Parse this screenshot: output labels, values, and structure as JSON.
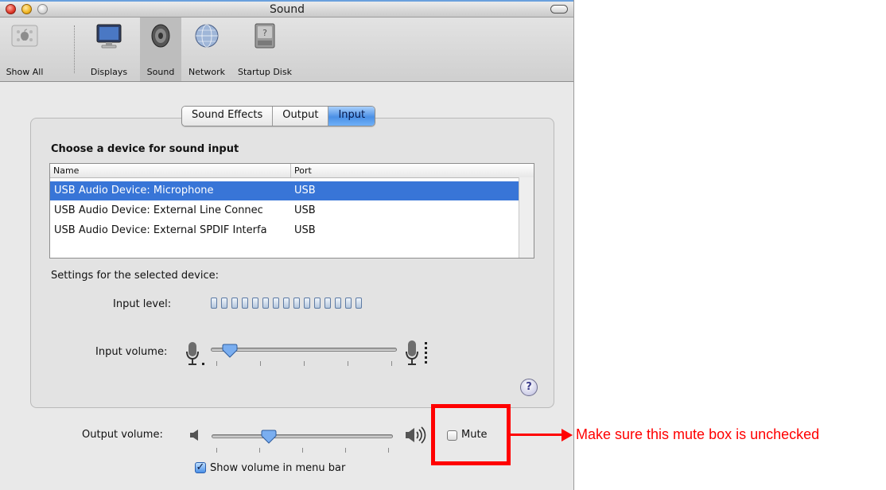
{
  "window": {
    "title": "Sound"
  },
  "toolbar": {
    "items": [
      {
        "label": "Show All",
        "icon": "apple-icon"
      },
      {
        "label": "Displays",
        "icon": "display-icon"
      },
      {
        "label": "Sound",
        "icon": "speaker-icon"
      },
      {
        "label": "Network",
        "icon": "globe-icon"
      },
      {
        "label": "Startup Disk",
        "icon": "disk-icon"
      }
    ],
    "selected": "Sound"
  },
  "tabs": [
    {
      "label": "Sound Effects",
      "active": false
    },
    {
      "label": "Output",
      "active": false
    },
    {
      "label": "Input",
      "active": true
    }
  ],
  "input": {
    "heading": "Choose a device for sound input",
    "columns": {
      "name": "Name",
      "port": "Port"
    },
    "devices": [
      {
        "name": "USB Audio Device: Microphone",
        "port": "USB",
        "selected": true
      },
      {
        "name": "USB Audio Device: External Line Connec",
        "port": "USB",
        "selected": false
      },
      {
        "name": "USB Audio Device: External SPDIF Interfa",
        "port": "USB",
        "selected": false
      }
    ],
    "settings_label": "Settings for the selected device:",
    "input_level_label": "Input level:",
    "input_level_segments": 15,
    "input_level_lit": 0,
    "input_volume_label": "Input volume:",
    "input_volume_fraction": 0.05
  },
  "output": {
    "output_volume_label": "Output volume:",
    "output_volume_fraction": 0.3,
    "mute_label": "Mute",
    "mute_checked": false,
    "show_volume_label": "Show volume in menu bar",
    "show_volume_checked": true
  },
  "help": {
    "glyph": "?"
  },
  "annotation": {
    "text": "Make sure this mute box is unchecked",
    "color": "#ff0000"
  },
  "colors": {
    "selection": "#3875d7",
    "active_tab": "#4b90e6"
  }
}
